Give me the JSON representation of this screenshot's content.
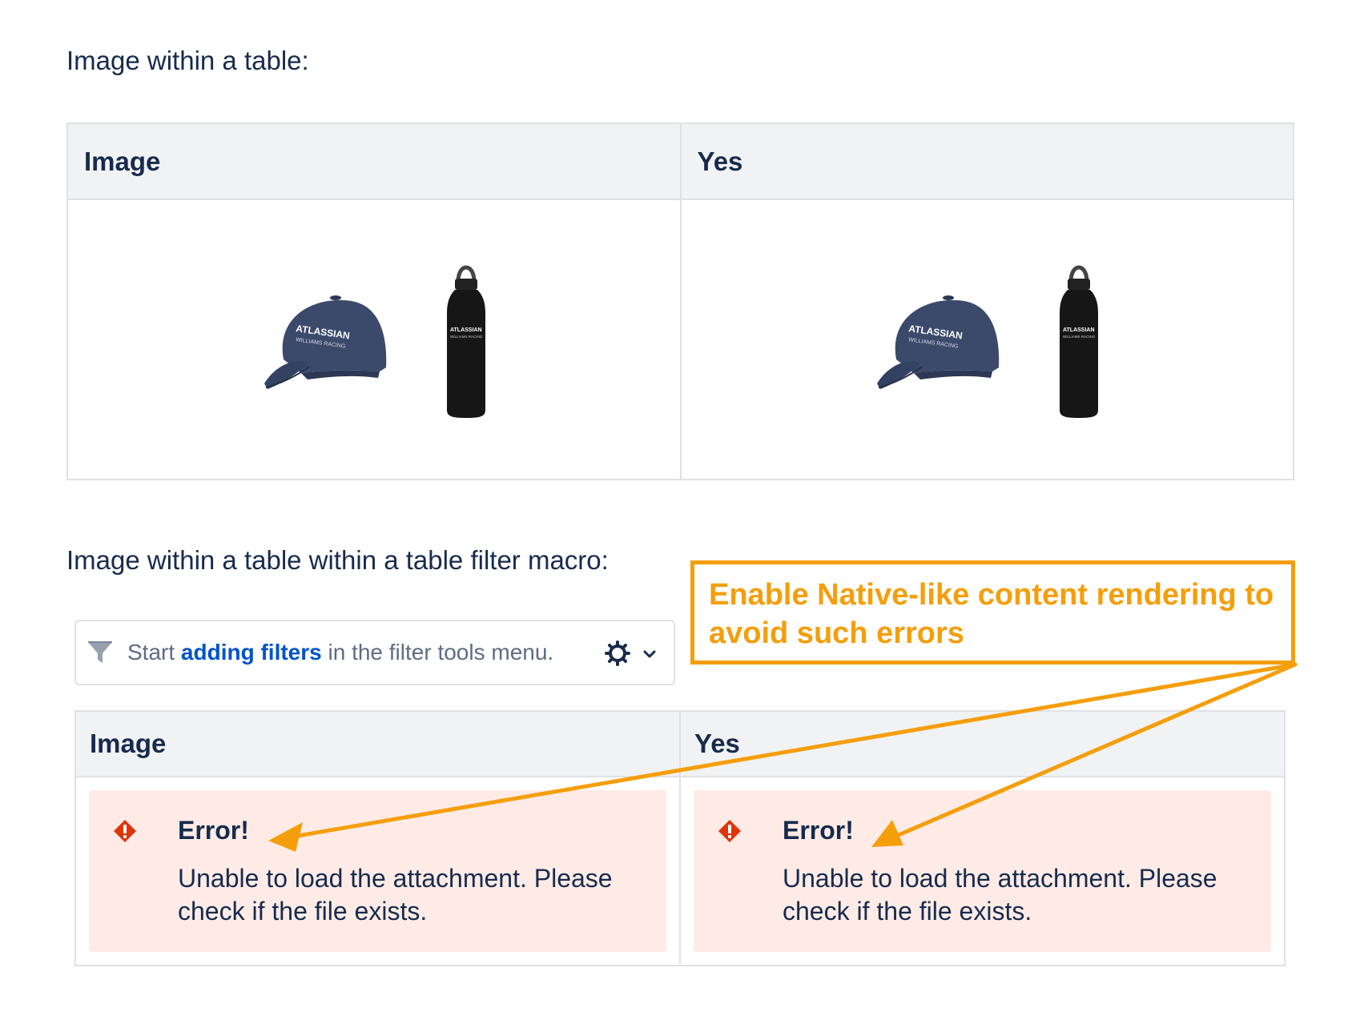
{
  "section1": {
    "label": "Image within a table:"
  },
  "table1": {
    "headers": [
      "Image",
      "Yes"
    ],
    "cells": [
      {
        "cap_brand": "ATLASSIAN",
        "cap_sub": "WILLIAMS RACING",
        "bottle_brand": "ATLASSIAN",
        "bottle_sub": "WILLIAMS RACING"
      },
      {
        "cap_brand": "ATLASSIAN",
        "cap_sub": "WILLIAMS RACING",
        "bottle_brand": "ATLASSIAN",
        "bottle_sub": "WILLIAMS RACING"
      }
    ]
  },
  "section2": {
    "label": "Image within a table within a table filter macro:"
  },
  "filter_bar": {
    "prefix": "Start",
    "link": "adding filters",
    "suffix": "in the filter tools menu.",
    "icons": [
      "funnel-icon",
      "gear-icon",
      "chevron-down-icon"
    ]
  },
  "table2": {
    "headers": [
      "Image",
      "Yes"
    ],
    "errors": [
      {
        "title": "Error!",
        "message": "Unable to load the attachment. Please check if the file exists."
      },
      {
        "title": "Error!",
        "message": "Unable to load the attachment. Please check if the file exists."
      }
    ]
  },
  "annotation": {
    "text": "Enable Native-like content rendering to avoid such errors",
    "color": "#f59e0b"
  },
  "colors": {
    "text": "#172b4d",
    "link": "#0052cc",
    "header_bg": "#f1f2f4",
    "error_bg": "#ffebe6",
    "error_icon": "#de350b"
  }
}
